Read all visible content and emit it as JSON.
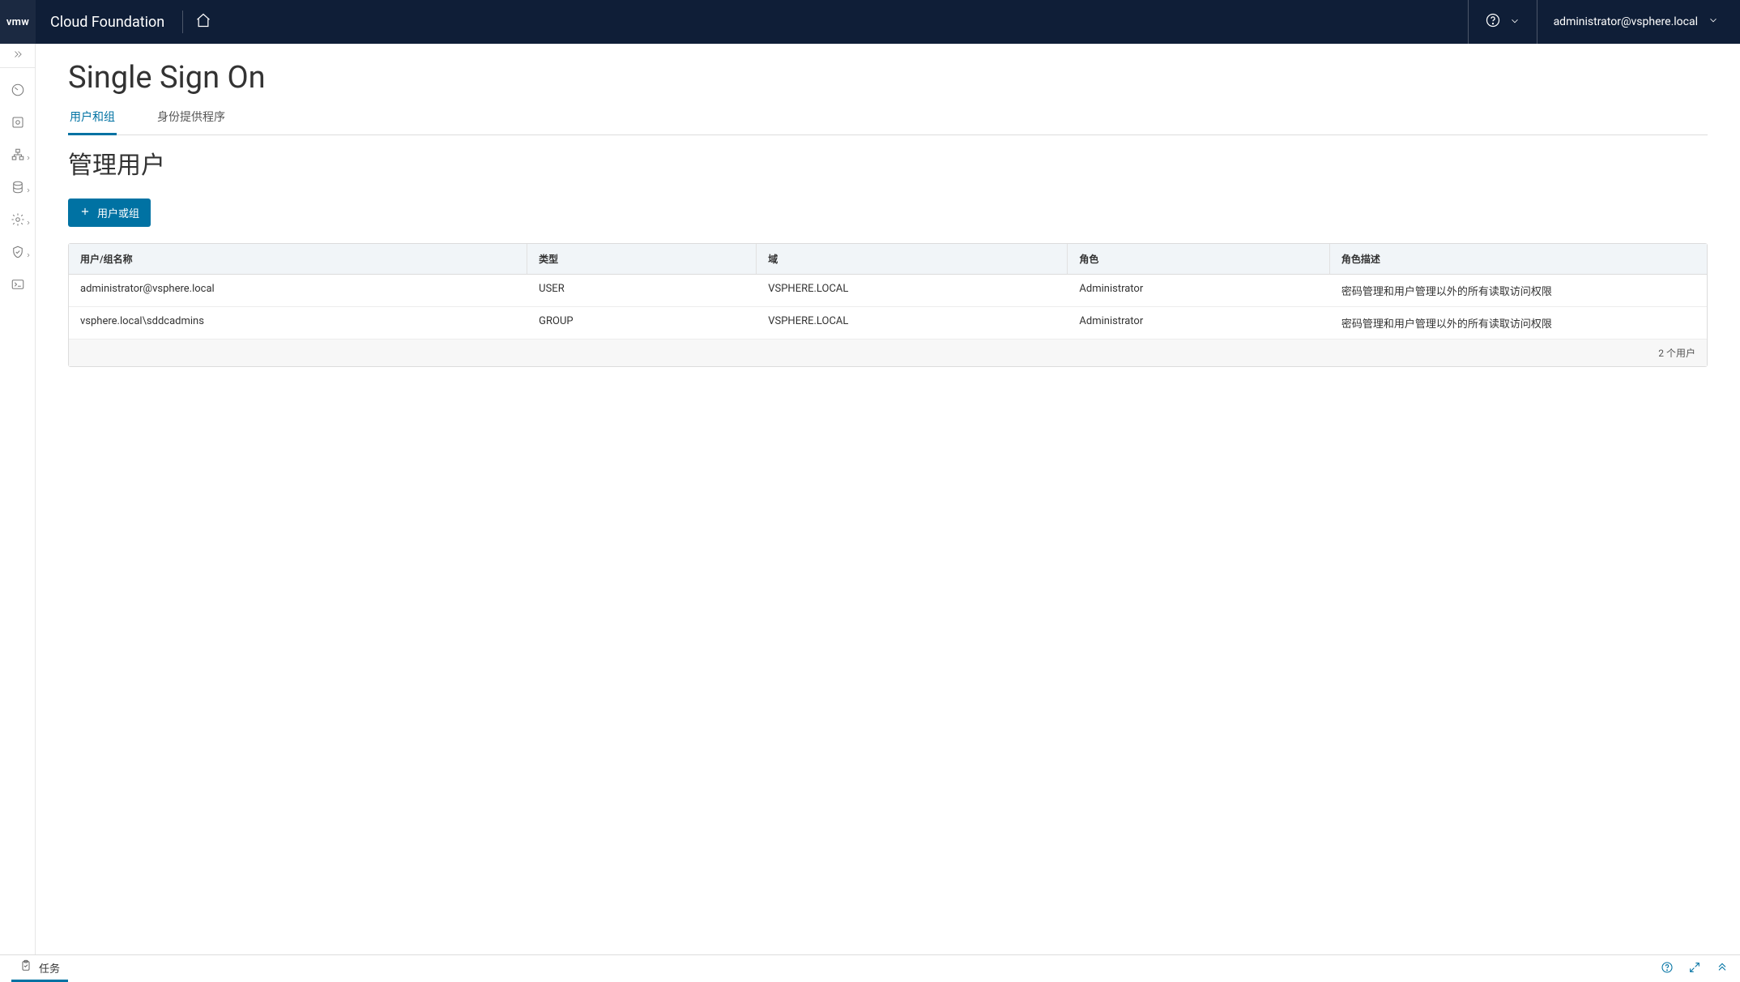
{
  "header": {
    "logo_text": "vmw",
    "product_name": "Cloud Foundation",
    "user_label": "administrator@vsphere.local"
  },
  "page": {
    "title": "Single Sign On",
    "tabs": [
      {
        "label": "用户和组",
        "active": true
      },
      {
        "label": "身份提供程序",
        "active": false
      }
    ],
    "section_title": "管理用户",
    "add_button_label": "用户或组"
  },
  "table": {
    "columns": {
      "name": "用户/组名称",
      "type": "类型",
      "domain": "域",
      "role": "角色",
      "desc": "角色描述"
    },
    "rows": [
      {
        "name": "administrator@vsphere.local",
        "type": "USER",
        "domain": "VSPHERE.LOCAL",
        "role": "Administrator",
        "desc": "密码管理和用户管理以外的所有读取访问权限"
      },
      {
        "name": "vsphere.local\\sddcadmins",
        "type": "GROUP",
        "domain": "VSPHERE.LOCAL",
        "role": "Administrator",
        "desc": "密码管理和用户管理以外的所有读取访问权限"
      }
    ],
    "footer": "2 个用户"
  },
  "bottombar": {
    "tasks_label": "任务"
  }
}
